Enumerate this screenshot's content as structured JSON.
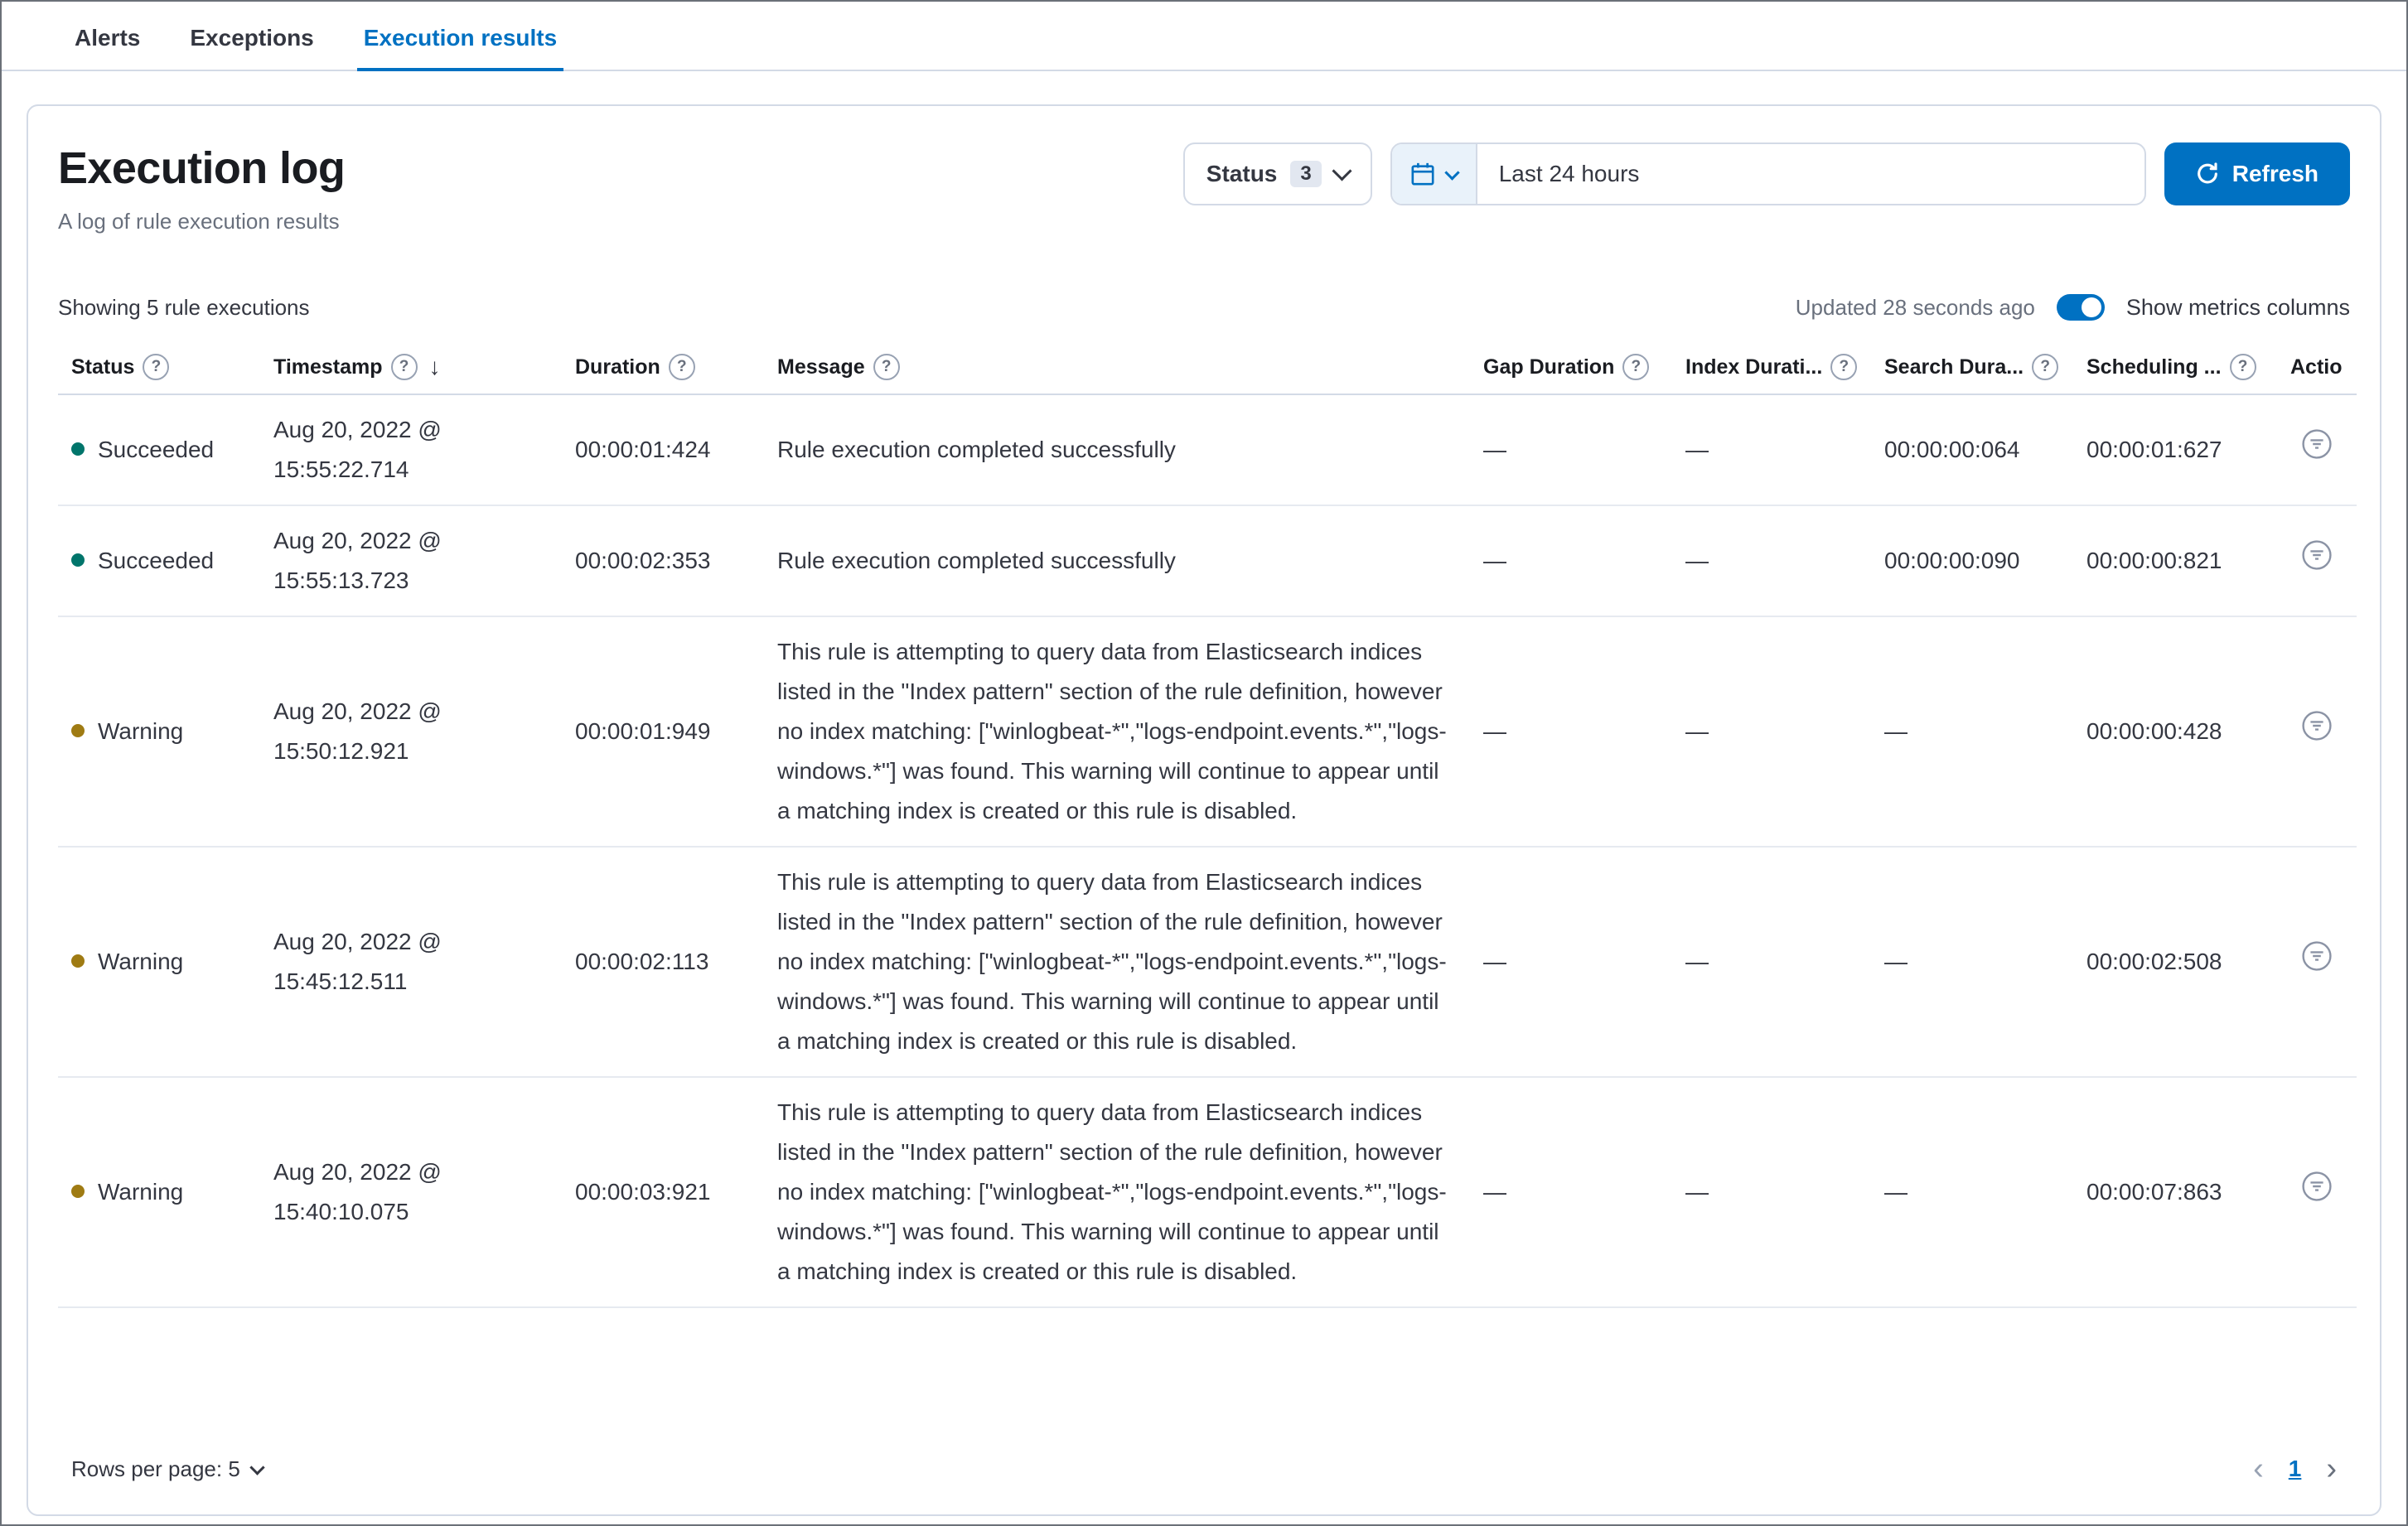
{
  "tabs": [
    {
      "label": "Alerts",
      "active": false
    },
    {
      "label": "Exceptions",
      "active": false
    },
    {
      "label": "Execution results",
      "active": true
    }
  ],
  "header": {
    "title": "Execution log",
    "subtitle": "A log of rule execution results",
    "status_filter": {
      "label": "Status",
      "count": "3"
    },
    "date_picker": {
      "value": "Last 24 hours"
    },
    "refresh_label": "Refresh"
  },
  "toolbar": {
    "showing_text": "Showing 5 rule executions",
    "updated_text": "Updated 28 seconds ago",
    "metrics_toggle_label": "Show metrics columns",
    "metrics_toggle_on": true
  },
  "table": {
    "columns": [
      {
        "label": "Status"
      },
      {
        "label": "Timestamp",
        "sorted": "desc"
      },
      {
        "label": "Duration"
      },
      {
        "label": "Message"
      },
      {
        "label": "Gap Duration"
      },
      {
        "label": "Index Durati..."
      },
      {
        "label": "Search Dura..."
      },
      {
        "label": "Scheduling ..."
      },
      {
        "label": "Actions"
      }
    ],
    "rows": [
      {
        "status_type": "succeeded",
        "status_label": "Succeeded",
        "timestamp": "Aug 20, 2022 @ 15:55:22.714",
        "duration": "00:00:01:424",
        "message": "Rule execution completed successfully",
        "gap_duration": "—",
        "index_duration": "—",
        "search_duration": "00:00:00:064",
        "scheduling_delay": "00:00:01:627"
      },
      {
        "status_type": "succeeded",
        "status_label": "Succeeded",
        "timestamp": "Aug 20, 2022 @ 15:55:13.723",
        "duration": "00:00:02:353",
        "message": "Rule execution completed successfully",
        "gap_duration": "—",
        "index_duration": "—",
        "search_duration": "00:00:00:090",
        "scheduling_delay": "00:00:00:821"
      },
      {
        "status_type": "warning",
        "status_label": "Warning",
        "timestamp": "Aug 20, 2022 @ 15:50:12.921",
        "duration": "00:00:01:949",
        "message": "This rule is attempting to query data from Elasticsearch indices listed in the \"Index pattern\" section of the rule definition, however no index matching: [\"winlogbeat-*\",\"logs-endpoint.events.*\",\"logs-windows.*\"] was found. This warning will continue to appear until a matching index is created or this rule is disabled.",
        "gap_duration": "—",
        "index_duration": "—",
        "search_duration": "—",
        "scheduling_delay": "00:00:00:428"
      },
      {
        "status_type": "warning",
        "status_label": "Warning",
        "timestamp": "Aug 20, 2022 @ 15:45:12.511",
        "duration": "00:00:02:113",
        "message": "This rule is attempting to query data from Elasticsearch indices listed in the \"Index pattern\" section of the rule definition, however no index matching: [\"winlogbeat-*\",\"logs-endpoint.events.*\",\"logs-windows.*\"] was found. This warning will continue to appear until a matching index is created or this rule is disabled.",
        "gap_duration": "—",
        "index_duration": "—",
        "search_duration": "—",
        "scheduling_delay": "00:00:02:508"
      },
      {
        "status_type": "warning",
        "status_label": "Warning",
        "timestamp": "Aug 20, 2022 @ 15:40:10.075",
        "duration": "00:00:03:921",
        "message": "This rule is attempting to query data from Elasticsearch indices listed in the \"Index pattern\" section of the rule definition, however no index matching: [\"winlogbeat-*\",\"logs-endpoint.events.*\",\"logs-windows.*\"] was found. This warning will continue to appear until a matching index is created or this rule is disabled.",
        "gap_duration": "—",
        "index_duration": "—",
        "search_duration": "—",
        "scheduling_delay": "00:00:07:863"
      }
    ]
  },
  "footer": {
    "rows_per_page_label": "Rows per page: 5",
    "page_number": "1"
  },
  "icons": {
    "help": "?",
    "sort_desc": "↓",
    "previous_page": "‹",
    "next_page": "›"
  },
  "colors": {
    "primary": "#0071c2",
    "success_dot": "#00756b",
    "warning_dot": "#9f7b13"
  }
}
